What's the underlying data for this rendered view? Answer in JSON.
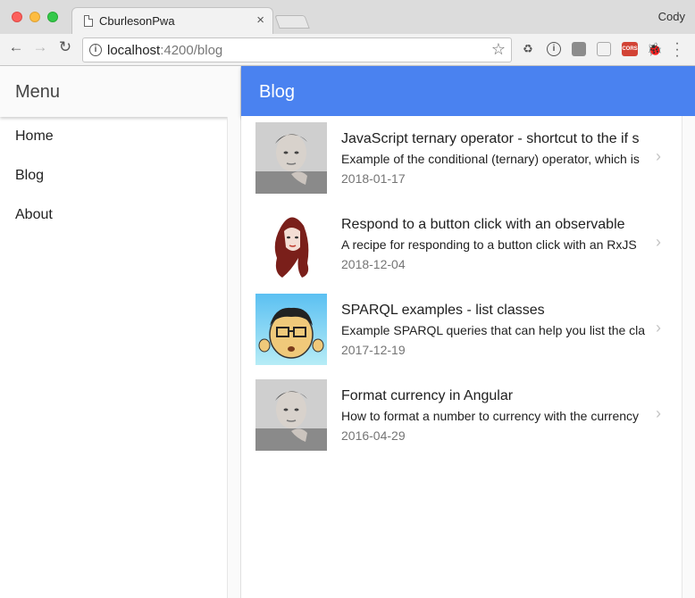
{
  "browser": {
    "tab_title": "CburlesonPwa",
    "tab_close": "×",
    "profile_name": "Cody",
    "url_host": "localhost",
    "url_path": ":4200/blog",
    "extensions": [
      {
        "name": "recycle-icon",
        "glyph": "♻"
      },
      {
        "name": "info-icon",
        "glyph": "i"
      },
      {
        "name": "note-icon",
        "glyph": ""
      },
      {
        "name": "box-icon",
        "glyph": ""
      },
      {
        "name": "cors-icon",
        "glyph": "CORS"
      },
      {
        "name": "bug-icon",
        "glyph": "🐞"
      }
    ]
  },
  "sidenav": {
    "title": "Menu",
    "items": [
      {
        "label": "Home"
      },
      {
        "label": "Blog"
      },
      {
        "label": "About"
      }
    ]
  },
  "appbar": {
    "title": "Blog"
  },
  "posts": [
    {
      "title": "JavaScript ternary operator - shortcut to the if s",
      "description": "Example of the conditional (ternary) operator, which is",
      "date": "2018-01-17",
      "avatar": "author-photo"
    },
    {
      "title": "Respond to a button click with an observable",
      "description": "A recipe for responding to a button click with an RxJS",
      "date": "2018-12-04",
      "avatar": "red-hair-illustration"
    },
    {
      "title": "SPARQL examples - list classes",
      "description": "Example SPARQL queries that can help you list the cla",
      "date": "2017-12-19",
      "avatar": "cartoon-face"
    },
    {
      "title": "Format currency in Angular",
      "description": "How to format a number to currency with the currency",
      "date": "2016-04-29",
      "avatar": "author-photo"
    }
  ],
  "colors": {
    "appbar": "#4a82f0",
    "sidenav_header": "#fafafa",
    "date_text": "#757575"
  }
}
